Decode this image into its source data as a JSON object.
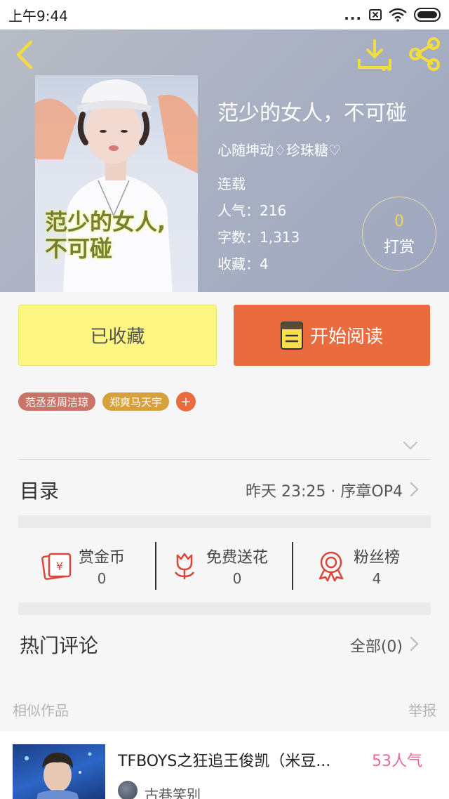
{
  "statusbar": {
    "time": "上午9:44",
    "dots": "..."
  },
  "book": {
    "title": "范少的女人，不可碰",
    "author": "心随坤动♢珍珠糖♡",
    "status": "连载",
    "popularity": "人气：216",
    "word_count": "字数：1,313",
    "favorites": "收藏：4",
    "cover_text_line1": "范少的女人,",
    "cover_text_line2": "不可碰"
  },
  "tip": {
    "count": "0",
    "label": "打赏"
  },
  "buttons": {
    "favorited": "已收藏",
    "start_reading": "开始阅读"
  },
  "tags": [
    {
      "label": "范丞丞周洁琼",
      "color": "#c97468"
    },
    {
      "label": "郑爽马天宇",
      "color": "#d4a13c"
    }
  ],
  "tag_add": "+",
  "toc": {
    "label": "目录",
    "latest": "昨天 23:25 · 序章OP4"
  },
  "stats": [
    {
      "label": "赏金币",
      "value": "0"
    },
    {
      "label": "免费送花",
      "value": "0"
    },
    {
      "label": "粉丝榜",
      "value": "4"
    }
  ],
  "comments": {
    "label": "热门评论",
    "all": "全部(0)"
  },
  "similar": {
    "header": "相似作品",
    "report": "举报",
    "items": [
      {
        "title": "TFBOYS之狂追王俊凯（米豆...",
        "popularity": "53人气",
        "author": "古巷笑别"
      }
    ]
  },
  "colors": {
    "accent_orange": "#ea6b3d",
    "accent_yellow": "#fef683",
    "gold": "#f5d350",
    "stat_icon_red": "#d9463a"
  }
}
